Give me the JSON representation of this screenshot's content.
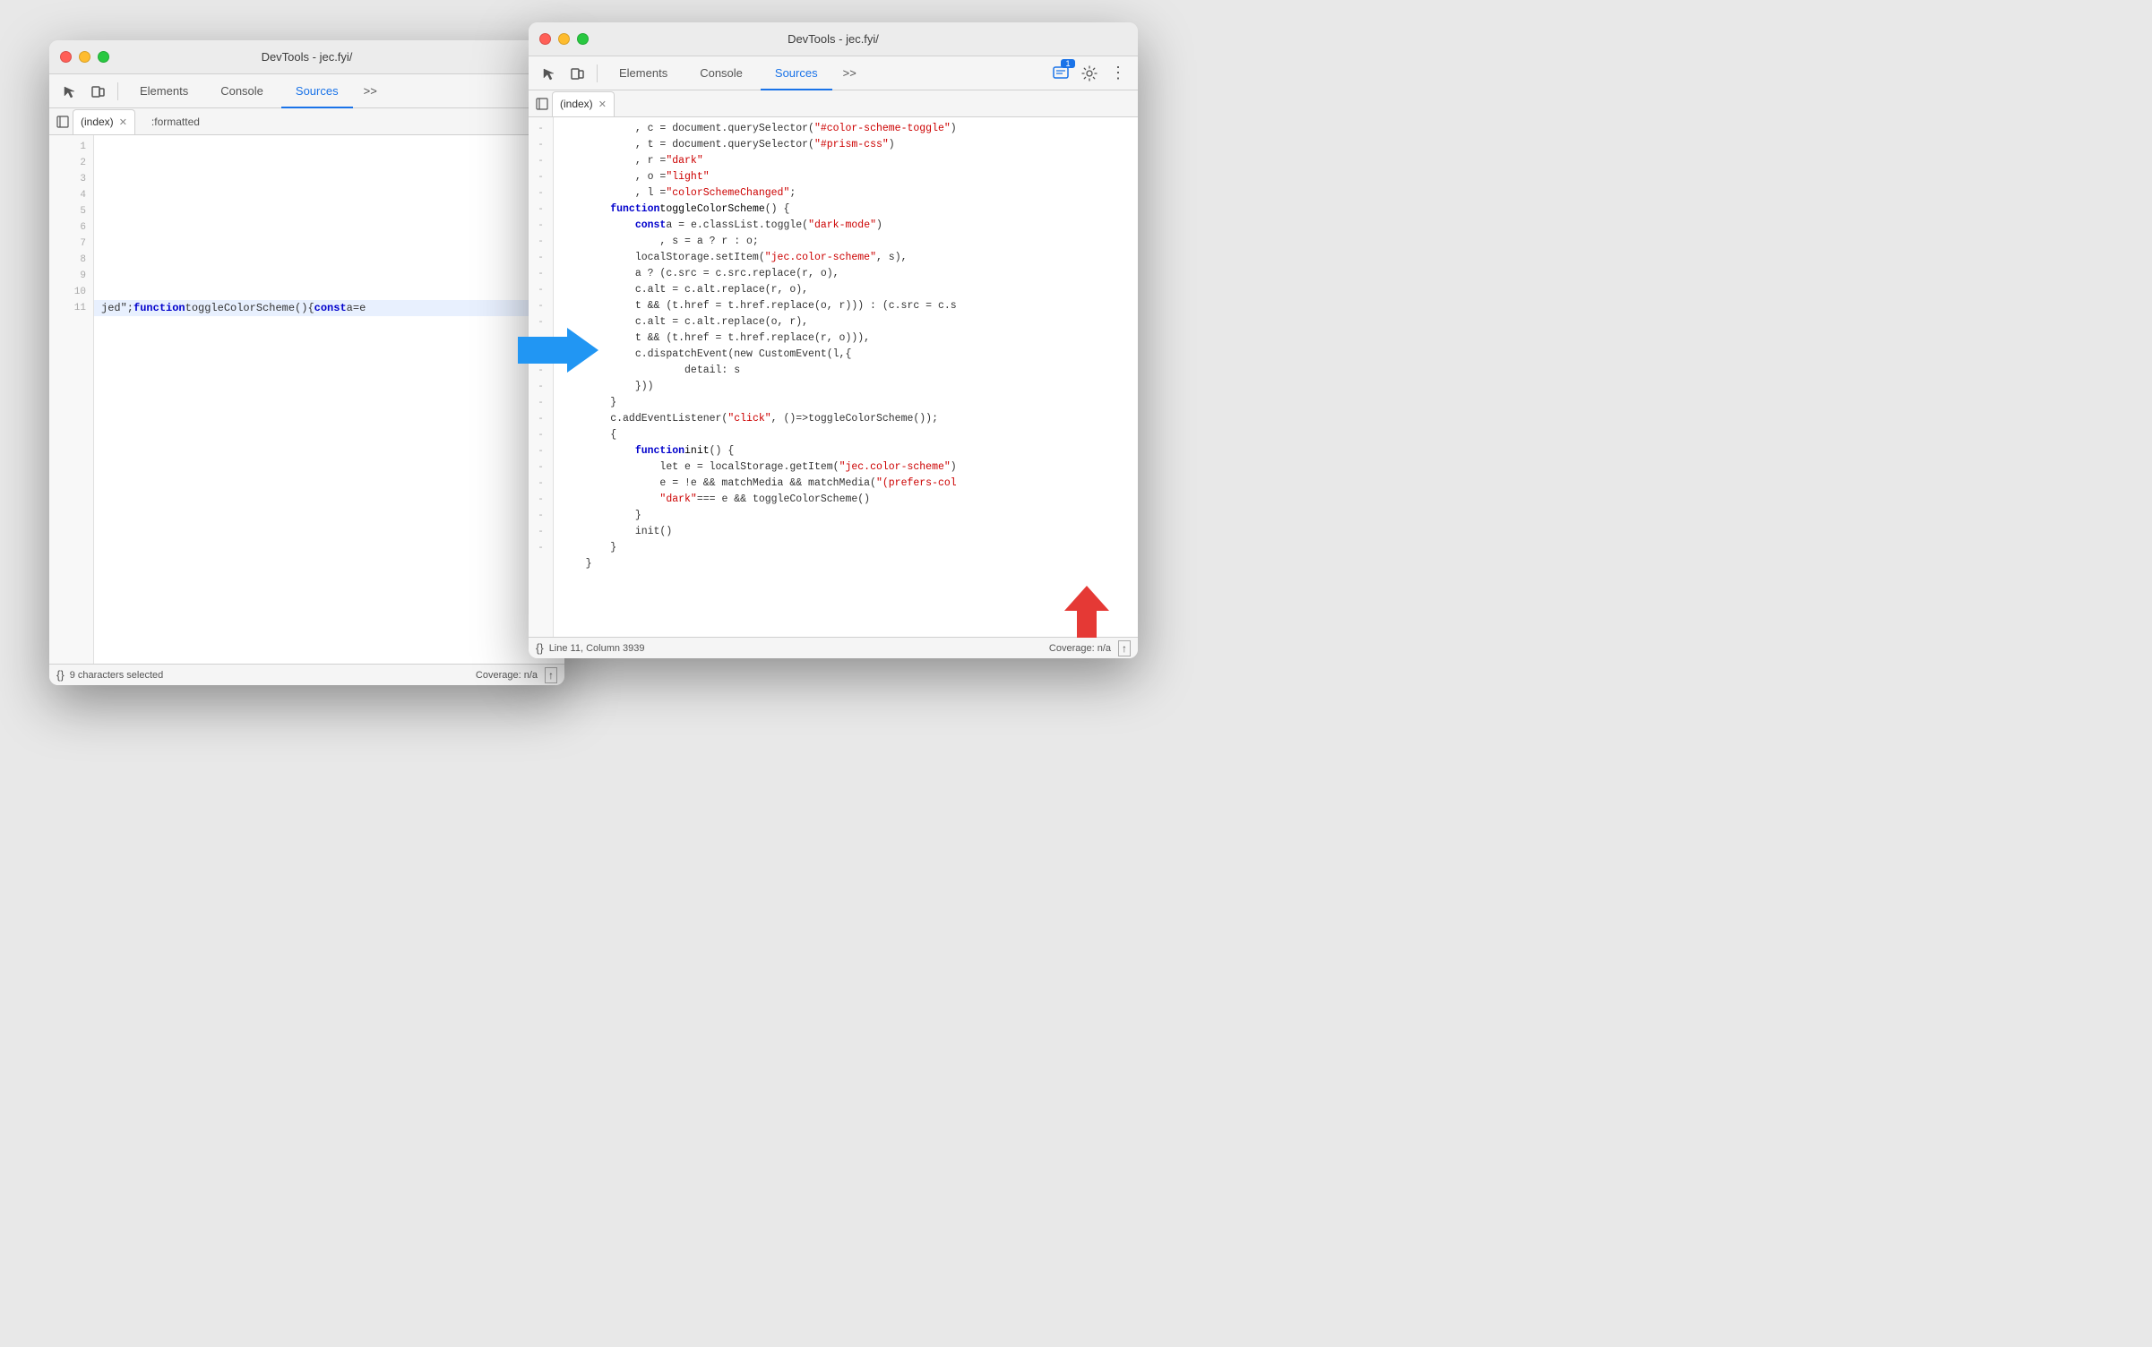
{
  "window1": {
    "title": "DevTools - jec.fyi/",
    "tabs": [
      {
        "label": "Elements",
        "active": false
      },
      {
        "label": "Console",
        "active": false
      },
      {
        "label": "Sources",
        "active": true
      }
    ],
    "more_tabs": ">>",
    "file_tabs": [
      {
        "label": "(index)",
        "closeable": true
      },
      {
        "label": ":formatted",
        "closeable": false
      }
    ],
    "status": {
      "left": "{}",
      "text": "9 characters selected",
      "coverage": "Coverage: n/a"
    },
    "lines": [
      {
        "num": 1,
        "code": ""
      },
      {
        "num": 2,
        "code": ""
      },
      {
        "num": 3,
        "code": ""
      },
      {
        "num": 4,
        "code": ""
      },
      {
        "num": 5,
        "code": ""
      },
      {
        "num": 6,
        "code": ""
      },
      {
        "num": 7,
        "code": ""
      },
      {
        "num": 8,
        "code": ""
      },
      {
        "num": 9,
        "code": ""
      },
      {
        "num": 10,
        "code": ""
      },
      {
        "num": 11,
        "code": "jed\";function toggleColorScheme(){const a=e",
        "highlighted": true
      }
    ]
  },
  "window2": {
    "title": "DevTools - jec.fyi/",
    "tabs": [
      {
        "label": "Elements",
        "active": false
      },
      {
        "label": "Console",
        "active": false
      },
      {
        "label": "Sources",
        "active": true
      }
    ],
    "more_tabs": ">>",
    "badge": "1",
    "file_tabs": [
      {
        "label": "(index)",
        "closeable": true
      }
    ],
    "status": {
      "left": "{}",
      "position": "Line 11, Column 3939",
      "coverage": "Coverage: n/a"
    },
    "code_lines": [
      {
        "gutter": "-",
        "code": "        , c = document.querySelector(",
        "str": "\"#color-scheme-toggle\"",
        "end": ")"
      },
      {
        "gutter": "-",
        "code": "        , t = document.querySelector(",
        "str": "\"#prism-css\"",
        "end": ")"
      },
      {
        "gutter": "-",
        "code": "        , r = ",
        "str": "\"dark\""
      },
      {
        "gutter": "-",
        "code": "        , o = ",
        "str": "\"light\""
      },
      {
        "gutter": "-",
        "code": "        , l = ",
        "str": "\"colorSchemeChanged\"",
        "end": ";"
      },
      {
        "gutter": "-",
        "code_kw": "        function ",
        "fn": "toggleColorScheme",
        "end": "() {"
      },
      {
        "gutter": "-",
        "code": "            ",
        "kw": "const",
        "rest": " a = e.classList.toggle(",
        "str": "\"dark-mode\"",
        "end": ")"
      },
      {
        "gutter": "-",
        "code": "              , s = a ? r : o;"
      },
      {
        "gutter": "-",
        "code": "            localStorage.setItem(",
        "str": "\"jec.color-scheme\"",
        "end": ", s),"
      },
      {
        "gutter": "-",
        "code": "            a ? (c.src = c.src.replace(r, o),"
      },
      {
        "gutter": "-",
        "code": "            c.alt = c.alt.replace(r, o),"
      },
      {
        "gutter": "-",
        "code": "            t && (t.href = t.href.replace(o, r))) : (c.src = c.s"
      },
      {
        "gutter": "-",
        "code": "            c.alt = c.alt.replace(o, r),"
      },
      {
        "gutter": "-",
        "code": "            t && (t.href = t.href.replace(r, o))),"
      },
      {
        "gutter": "-",
        "code": "            c.dispatchEvent(new CustomEvent(l,{"
      },
      {
        "gutter": "-",
        "code": "                detail: s"
      },
      {
        "gutter": "-",
        "code": "            }))"
      },
      {
        "gutter": "-",
        "code": "        }"
      },
      {
        "gutter": "-",
        "code": "        c.addEventListener(",
        "str": "\"click\"",
        "end": ", ()=>toggleColorScheme());"
      },
      {
        "gutter": "-",
        "code": "        {"
      },
      {
        "gutter": "-",
        "code_kw": "            function ",
        "fn": "init",
        "end": "() {"
      },
      {
        "gutter": "-",
        "code": "                let e = localStorage.getItem(",
        "str": "\"jec.color-scheme\"",
        "end": ")"
      },
      {
        "gutter": "-",
        "code": "                e = !e && matchMedia && matchMedia(",
        "str": "\"(prefers-col"
      },
      {
        "gutter": "-",
        "code": "                ",
        "str": "\"dark\"",
        "end": " === e && toggleColorScheme()"
      },
      {
        "gutter": "-",
        "code": "            }"
      },
      {
        "gutter": "-",
        "code": "            init()"
      },
      {
        "gutter": "-",
        "code": "        }"
      },
      {
        "gutter": " ",
        "code": "    }"
      }
    ]
  },
  "icons": {
    "inspect": "⬚",
    "device": "⬜",
    "gear": "⚙",
    "dots": "⋮",
    "format": "{}"
  }
}
